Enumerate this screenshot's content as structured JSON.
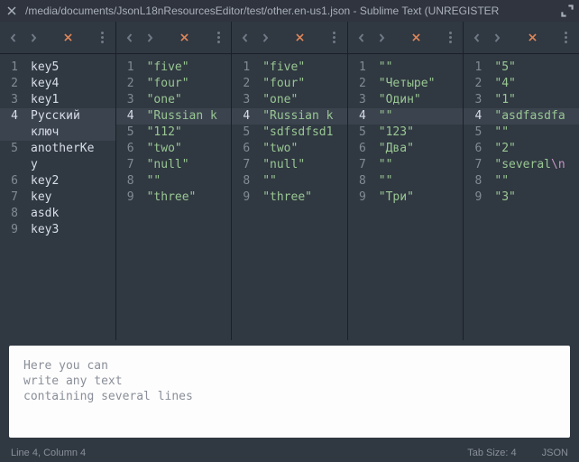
{
  "window": {
    "title": "/media/documents/JsonL18nResourcesEditor/test/other.en-us1.json - Sublime Text (UNREGISTER"
  },
  "panes": [
    {
      "highlight": 4,
      "wraps": {
        "4": 2
      },
      "lines": [
        {
          "n": "1",
          "t": "key5",
          "c": "key"
        },
        {
          "n": "2",
          "t": "key4",
          "c": "key"
        },
        {
          "n": "3",
          "t": "key1",
          "c": "key"
        },
        {
          "n": "4",
          "t": "Русский ключ",
          "c": "key"
        },
        {
          "n": "5",
          "t": "anotherKey",
          "c": "key"
        },
        {
          "n": "6",
          "t": "key2",
          "c": "key"
        },
        {
          "n": "7",
          "t": "key",
          "c": "key"
        },
        {
          "n": "8",
          "t": "asdk",
          "c": "key"
        },
        {
          "n": "9",
          "t": "key3",
          "c": "key"
        }
      ]
    },
    {
      "highlight": 4,
      "lines": [
        {
          "n": "1",
          "t": "\"five\"",
          "c": "str"
        },
        {
          "n": "2",
          "t": "\"four\"",
          "c": "str"
        },
        {
          "n": "3",
          "t": "\"one\"",
          "c": "str"
        },
        {
          "n": "4",
          "t": "\"Russian k",
          "c": "str"
        },
        {
          "n": "5",
          "t": "\"112\"",
          "c": "str"
        },
        {
          "n": "6",
          "t": "\"two\"",
          "c": "str"
        },
        {
          "n": "7",
          "t": "\"null\"",
          "c": "str"
        },
        {
          "n": "8",
          "t": "\"\"",
          "c": "str"
        },
        {
          "n": "9",
          "t": "\"three\"",
          "c": "str"
        }
      ]
    },
    {
      "highlight": 4,
      "lines": [
        {
          "n": "1",
          "t": "\"five\"",
          "c": "str"
        },
        {
          "n": "2",
          "t": "\"four\"",
          "c": "str"
        },
        {
          "n": "3",
          "t": "\"one\"",
          "c": "str"
        },
        {
          "n": "4",
          "t": "\"Russian k",
          "c": "str"
        },
        {
          "n": "5",
          "t": "\"sdfsdfsd1",
          "c": "str"
        },
        {
          "n": "6",
          "t": "\"two\"",
          "c": "str"
        },
        {
          "n": "7",
          "t": "\"null\"",
          "c": "str"
        },
        {
          "n": "8",
          "t": "\"\"",
          "c": "str"
        },
        {
          "n": "9",
          "t": "\"three\"",
          "c": "str"
        }
      ]
    },
    {
      "highlight": 4,
      "lines": [
        {
          "n": "1",
          "t": "\"\"",
          "c": "str"
        },
        {
          "n": "2",
          "t": "\"Четыре\"",
          "c": "str"
        },
        {
          "n": "3",
          "t": "\"Один\"",
          "c": "str"
        },
        {
          "n": "4",
          "t": "\"\"",
          "c": "str"
        },
        {
          "n": "5",
          "t": "\"123\"",
          "c": "str"
        },
        {
          "n": "6",
          "t": "\"Два\"",
          "c": "str"
        },
        {
          "n": "7",
          "t": "\"\"",
          "c": "str"
        },
        {
          "n": "8",
          "t": "\"\"",
          "c": "str"
        },
        {
          "n": "9",
          "t": "\"Три\"",
          "c": "str"
        }
      ]
    },
    {
      "highlight": 4,
      "lines": [
        {
          "n": "1",
          "t": "\"5\"",
          "c": "str"
        },
        {
          "n": "2",
          "t": "\"4\"",
          "c": "str"
        },
        {
          "n": "3",
          "t": "\"1\"",
          "c": "str"
        },
        {
          "n": "4",
          "t": "\"asdfasdfa",
          "c": "str"
        },
        {
          "n": "5",
          "t": "\"\"",
          "c": "str"
        },
        {
          "n": "6",
          "t": "\"2\"",
          "c": "str"
        },
        {
          "n": "7",
          "t": "\"several",
          "c": "str",
          "esc": "\\n"
        },
        {
          "n": "8",
          "t": "\"\"",
          "c": "str"
        },
        {
          "n": "9",
          "t": "\"3\"",
          "c": "str"
        }
      ]
    }
  ],
  "bottom": {
    "text": "Here you can\nwrite any text\ncontaining several lines"
  },
  "status": {
    "left": "Line 4, Column 4",
    "tab": "Tab Size: 4",
    "lang": "JSON"
  }
}
